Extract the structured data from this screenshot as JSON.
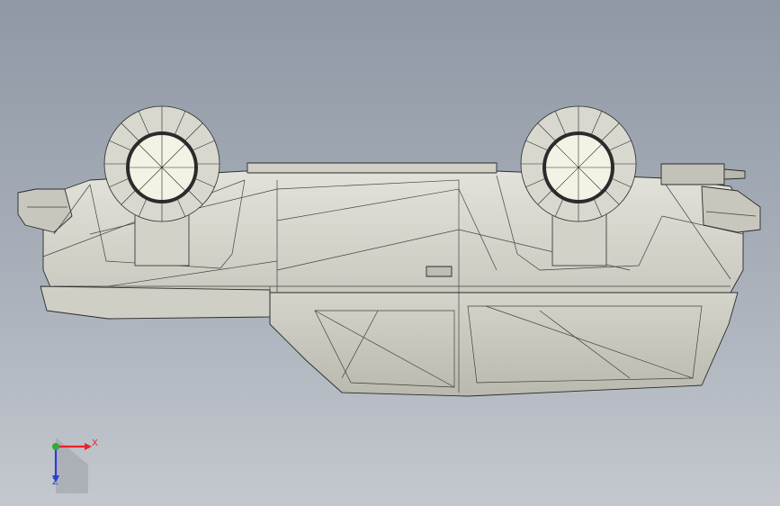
{
  "viewport": {
    "background_top": "#8f98a5",
    "background_bottom": "#c4c8ce"
  },
  "model": {
    "body_color": "#d8d8cf",
    "edge_color": "#2b2b2b",
    "display_style": "shaded-with-edges"
  },
  "triad": {
    "x_label": "X",
    "z_label": "Z",
    "x_color": "#e8232a",
    "y_color": "#2faa3c",
    "z_color": "#2b3fd1"
  }
}
